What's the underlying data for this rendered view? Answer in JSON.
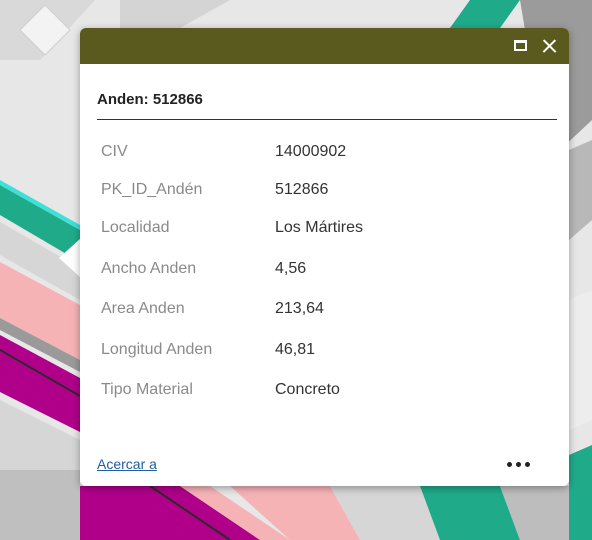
{
  "popup": {
    "title": "Anden: 512866",
    "actions": {
      "maximize_icon": "maximize-icon",
      "close_icon": "close-icon"
    },
    "attributes": [
      {
        "label": "CIV",
        "value": "14000902"
      },
      {
        "label": "PK_ID_Andén",
        "value": "512866"
      },
      {
        "label": "Localidad",
        "value": "Los Mártires"
      },
      {
        "label": "Ancho Anden",
        "value": "4,56"
      },
      {
        "label": "Area Anden",
        "value": "213,64"
      },
      {
        "label": "Longitud Anden",
        "value": "46,81"
      },
      {
        "label": "Tipo Material",
        "value": "Concreto"
      }
    ],
    "footer": {
      "zoom_label": "Acercar a",
      "more_icon": "more-options-icon"
    }
  },
  "colors": {
    "titlebar": "#5a5a1f",
    "link": "#1f5d9e",
    "map_teal": "#1fab8a",
    "map_pink": "#f6b3b6",
    "map_magenta": "#b0008a",
    "map_gray": "#8f8f8f"
  }
}
